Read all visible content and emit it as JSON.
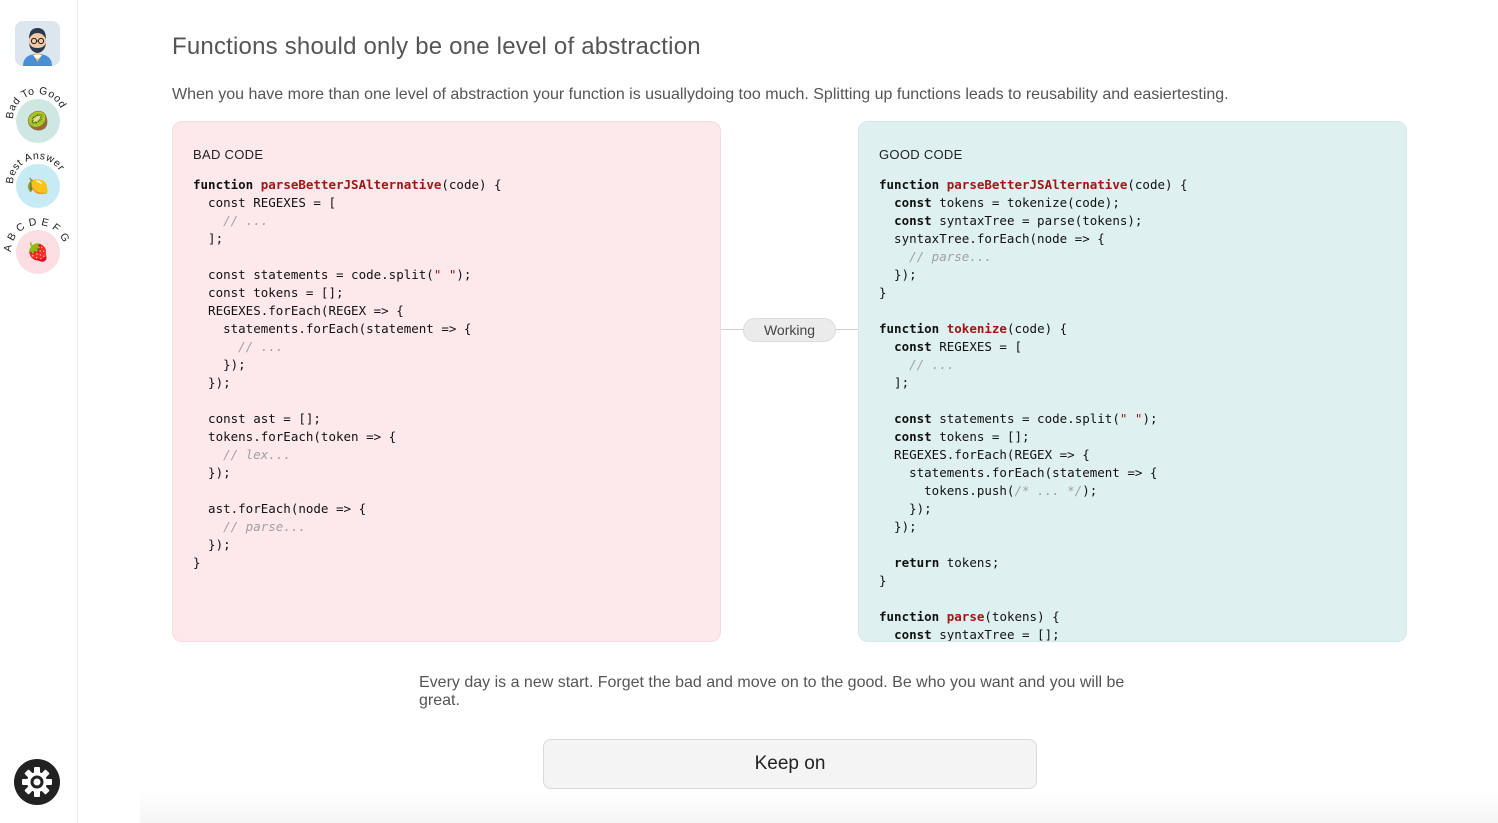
{
  "sidebar": {
    "items": [
      {
        "label": "Bad To Good",
        "icon": "kiwi-icon",
        "glyph": "🥝"
      },
      {
        "label": "Best Answer",
        "icon": "lemon-icon",
        "glyph": "🍋"
      },
      {
        "label": "A B C D E F G",
        "icon": "strawberry-icon",
        "glyph": "🍓"
      }
    ]
  },
  "main": {
    "title": "Functions should only be one level of abstraction",
    "description": "When you have more than one level of abstraction your function is usuallydoing too much. Splitting up functions leads to reusability and easiertesting.",
    "bad_label": "BAD CODE",
    "good_label": "GOOD CODE",
    "connector_label": "Working",
    "quote": "Every day is a new start. Forget the bad and move on to the good. Be who you want and you will be great.",
    "button_label": "Keep on"
  },
  "colors": {
    "bad_panel": "#fde8ec",
    "good_panel": "#def0ef",
    "function_name": "#a31515",
    "comment": "#a0a0a0"
  }
}
